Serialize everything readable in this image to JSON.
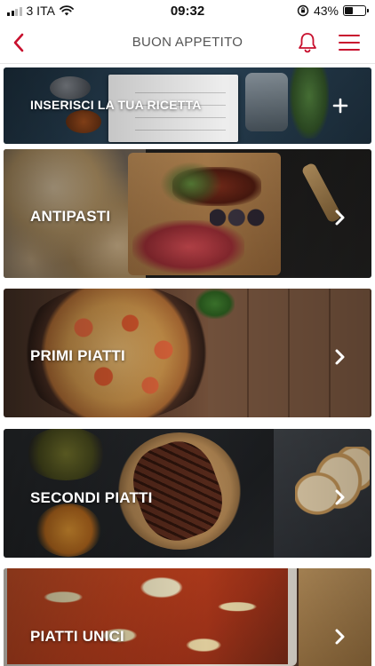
{
  "status_bar": {
    "carrier": "3 ITA",
    "time": "09:32",
    "battery": "43%",
    "battery_level": 0.43
  },
  "header": {
    "title": "BUON APPETITO",
    "icons": [
      "back-chevron-icon",
      "bell-icon",
      "hamburger-menu-icon"
    ]
  },
  "colors": {
    "accent": "#c8102e",
    "label": "#ffffff"
  },
  "cards": [
    {
      "label": "INSERISCI LA TUA RICETTA",
      "action_icon": "plus-icon"
    },
    {
      "label": "ANTIPASTI",
      "action_icon": "chevron-right-icon"
    },
    {
      "label": "PRIMI PIATTI",
      "action_icon": "chevron-right-icon"
    },
    {
      "label": "SECONDI PIATTI",
      "action_icon": "chevron-right-icon"
    },
    {
      "label": "PIATTI UNICI",
      "action_icon": "chevron-right-icon"
    }
  ]
}
